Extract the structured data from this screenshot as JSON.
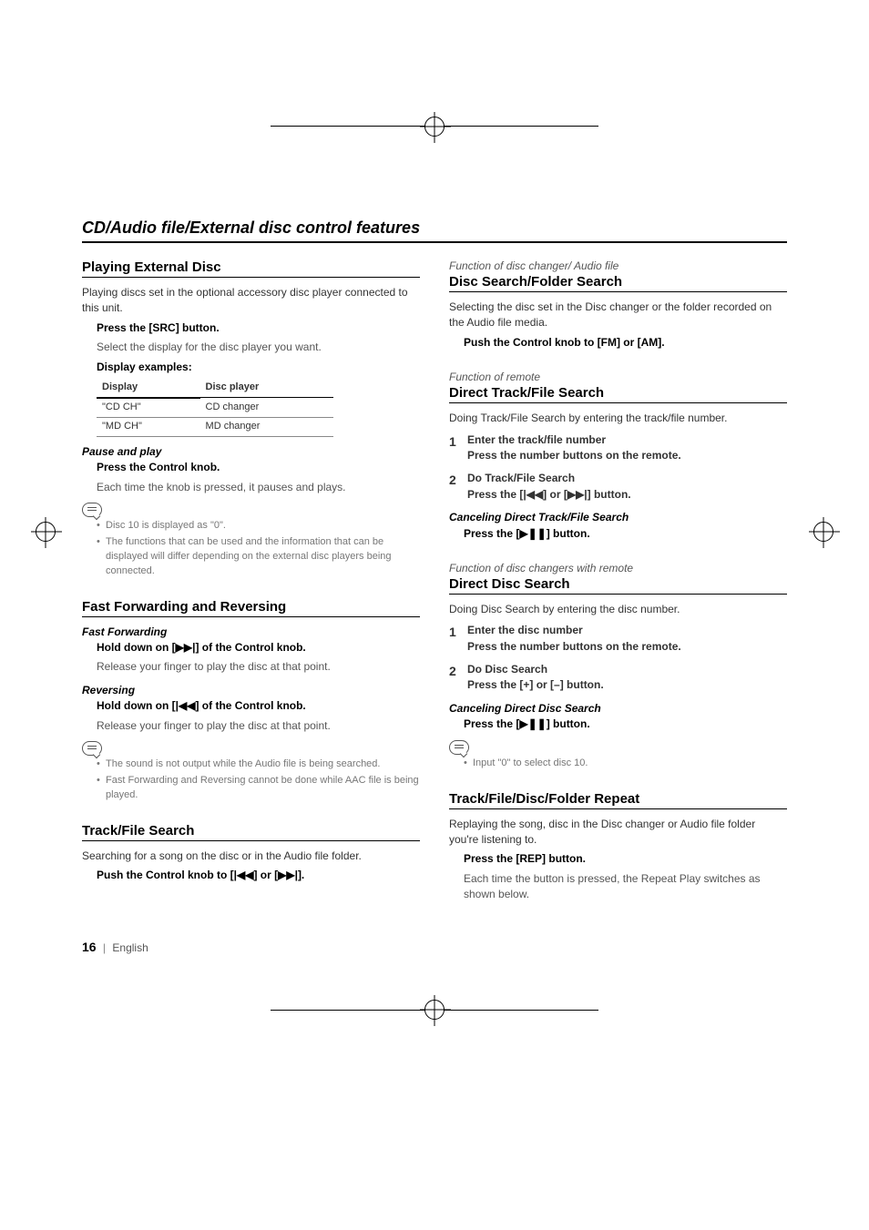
{
  "section_title": "CD/Audio file/External disc control features",
  "playing_external_disc": {
    "heading": "Playing External Disc",
    "intro": "Playing discs set in the optional accessory disc player connected to this unit.",
    "step_instr": "Press the [SRC] button.",
    "step_sub": "Select the display for the disc player you want.",
    "examples_label": "Display examples:",
    "table": {
      "headers": [
        "Display",
        "Disc player"
      ],
      "rows": [
        [
          "\"CD CH\"",
          "CD changer"
        ],
        [
          "\"MD CH\"",
          "MD changer"
        ]
      ]
    },
    "pause_play": {
      "heading": "Pause and play",
      "instr": "Press the Control knob.",
      "sub": "Each time the knob is pressed, it pauses and plays."
    },
    "notes": [
      "Disc 10 is displayed as \"0\".",
      "The functions that can be used and the information that can be displayed will differ depending on the external disc players being connected."
    ]
  },
  "fast_forward": {
    "heading": "Fast Forwarding and Reversing",
    "ff": {
      "heading": "Fast Forwarding",
      "instr": "Hold down on [▶▶|] of the Control knob.",
      "sub": "Release your finger to play the disc at that point."
    },
    "rev": {
      "heading": "Reversing",
      "instr": "Hold down on [|◀◀] of the Control knob.",
      "sub": "Release your finger to play the disc at that point."
    },
    "notes": [
      "The sound is not output while the Audio file is being searched.",
      "Fast Forwarding and Reversing cannot be done while AAC file is being played."
    ]
  },
  "track_file_search": {
    "heading": "Track/File Search",
    "intro": "Searching for a song on the disc or in the Audio file folder.",
    "instr": "Push the Control knob to [|◀◀] or [▶▶|]."
  },
  "disc_folder_search": {
    "context": "Function of disc changer/ Audio file",
    "heading": "Disc Search/Folder Search",
    "intro": "Selecting the disc set in the Disc changer or the folder recorded on the Audio file media.",
    "instr": "Push the Control knob to [FM] or [AM]."
  },
  "direct_track_search": {
    "context": "Function of remote",
    "heading": "Direct Track/File Search",
    "intro": "Doing Track/File Search by entering the track/file number.",
    "steps": [
      {
        "title": "Enter the track/file number",
        "body": "Press the number buttons on the remote."
      },
      {
        "title": "Do Track/File Search",
        "body": "Press the [|◀◀] or [▶▶|] button."
      }
    ],
    "cancel_heading": "Canceling Direct Track/File Search",
    "cancel_body": "Press the [▶❚❚] button."
  },
  "direct_disc_search": {
    "context": "Function of disc changers with remote",
    "heading": "Direct Disc Search",
    "intro": "Doing Disc Search by entering the disc number.",
    "steps": [
      {
        "title": "Enter the disc number",
        "body": "Press the number buttons on the remote."
      },
      {
        "title": "Do Disc Search",
        "body": "Press the [+] or [–] button."
      }
    ],
    "cancel_heading": "Canceling Direct Disc Search",
    "cancel_body": "Press the [▶❚❚] button.",
    "notes": [
      "Input \"0\" to select disc 10."
    ]
  },
  "repeat": {
    "heading": "Track/File/Disc/Folder Repeat",
    "intro": "Replaying the song, disc in the Disc changer or Audio file folder you're listening to.",
    "instr": "Press the [REP] button.",
    "sub": "Each time the button is pressed, the Repeat Play switches as shown below."
  },
  "footer": {
    "page": "16",
    "lang": "English"
  }
}
